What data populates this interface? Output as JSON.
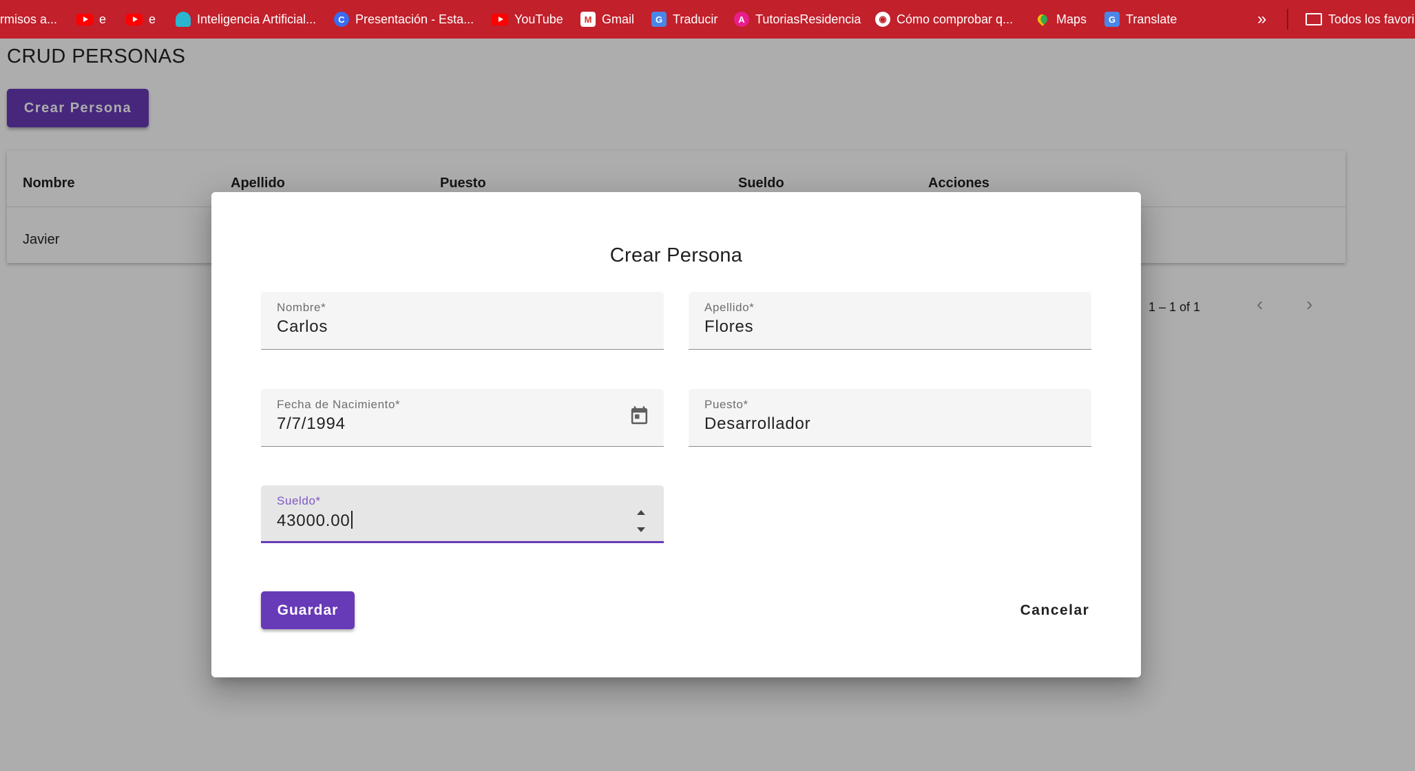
{
  "bookmarks": {
    "items": [
      {
        "label": "rmisos a...",
        "icon": "none"
      },
      {
        "label": "e",
        "icon": "youtube-icon"
      },
      {
        "label": "e",
        "icon": "youtube-icon"
      },
      {
        "label": "Inteligencia Artificial...",
        "icon": "robot-icon"
      },
      {
        "label": "Presentación - Esta...",
        "icon": "canva-icon"
      },
      {
        "label": "YouTube",
        "icon": "youtube-icon"
      },
      {
        "label": "Gmail",
        "icon": "gmail-icon"
      },
      {
        "label": "Traducir",
        "icon": "google-translate-icon"
      },
      {
        "label": "TutoriasResidencia",
        "icon": "tutorias-icon"
      },
      {
        "label": "Cómo comprobar q...",
        "icon": "globe-icon"
      },
      {
        "label": "Maps",
        "icon": "maps-icon"
      },
      {
        "label": "Translate",
        "icon": "google-translate-icon"
      }
    ],
    "more": "»",
    "all_bookmarks": "Todos los favori"
  },
  "page": {
    "title": "CRUD PERSONAS",
    "create_button": "Crear Persona",
    "table": {
      "headers": [
        "Nombre",
        "Apellido",
        "Puesto",
        "Sueldo",
        "Acciones"
      ],
      "rows": [
        [
          "Javier"
        ]
      ]
    },
    "paginator": {
      "range": "1 – 1 of 1",
      "prev": "‹",
      "next": "›"
    }
  },
  "dialog": {
    "title": "Crear Persona",
    "fields": {
      "nombre": {
        "label": "Nombre*",
        "value": "Carlos"
      },
      "apellido": {
        "label": "Apellido*",
        "value": "Flores"
      },
      "fecha": {
        "label": "Fecha de Nacimiento*",
        "value": "7/7/1994"
      },
      "puesto": {
        "label": "Puesto*",
        "value": "Desarrollador"
      },
      "sueldo": {
        "label": "Sueldo*",
        "value": "43000.00"
      }
    },
    "save_button": "Guardar",
    "cancel_button": "Cancelar"
  },
  "colors": {
    "bookmark_bar": "#c2202b",
    "primary": "#673ab7",
    "focused_label": "#7e57c2",
    "overlay": "rgba(0,0,0,0.32)"
  }
}
